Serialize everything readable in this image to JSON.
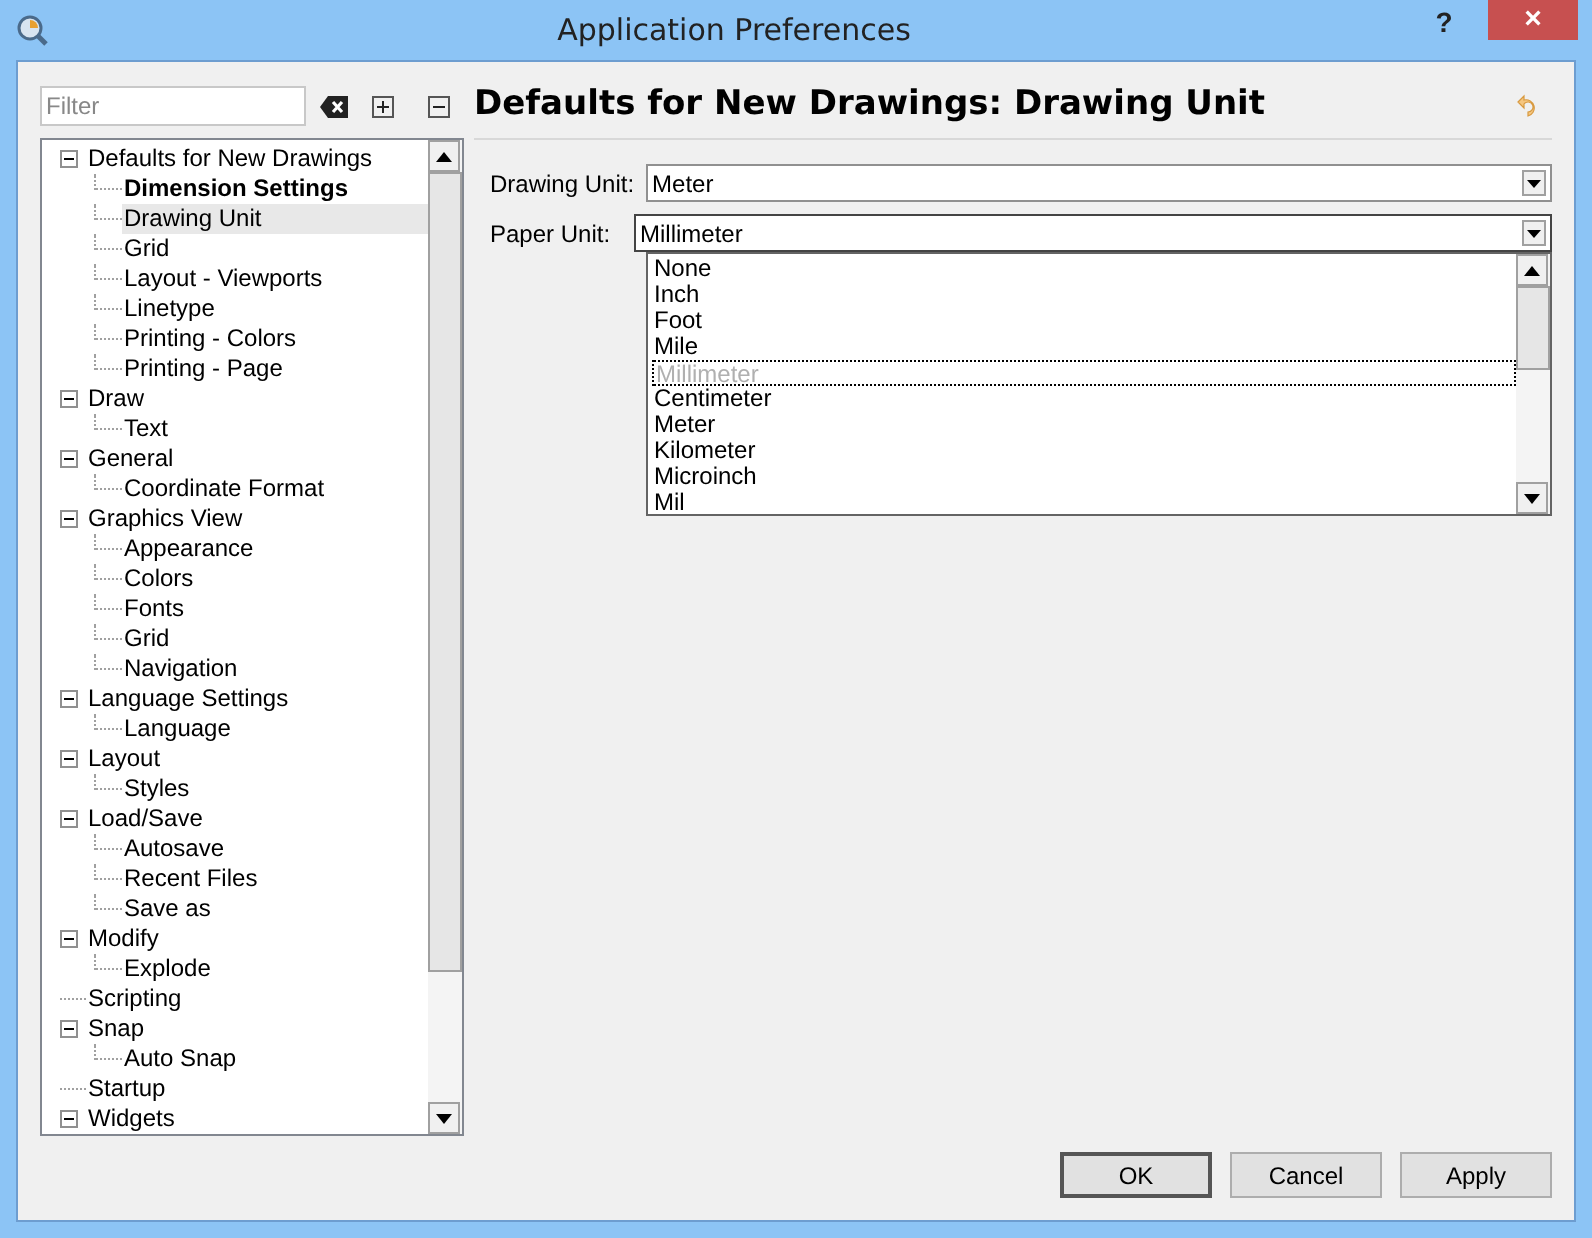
{
  "window": {
    "title": "Application Preferences",
    "help": "?",
    "close": "×"
  },
  "filter": {
    "placeholder": "Filter"
  },
  "tree": [
    {
      "label": "Defaults for New Drawings",
      "expanded": true,
      "selected": false,
      "children": [
        {
          "label": "Dimension Settings",
          "bold": true,
          "selected": false
        },
        {
          "label": "Drawing Unit",
          "bold": false,
          "selected": true
        },
        {
          "label": "Grid",
          "bold": false,
          "selected": false
        },
        {
          "label": "Layout - Viewports",
          "bold": false,
          "selected": false
        },
        {
          "label": "Linetype",
          "bold": false,
          "selected": false
        },
        {
          "label": "Printing - Colors",
          "bold": false,
          "selected": false
        },
        {
          "label": "Printing - Page",
          "bold": false,
          "selected": false
        }
      ]
    },
    {
      "label": "Draw",
      "expanded": true,
      "selected": false,
      "children": [
        {
          "label": "Text",
          "bold": false,
          "selected": false
        }
      ]
    },
    {
      "label": "General",
      "expanded": true,
      "selected": false,
      "children": [
        {
          "label": "Coordinate Format",
          "bold": false,
          "selected": false
        }
      ]
    },
    {
      "label": "Graphics View",
      "expanded": true,
      "selected": false,
      "children": [
        {
          "label": "Appearance",
          "bold": false,
          "selected": false
        },
        {
          "label": "Colors",
          "bold": false,
          "selected": false
        },
        {
          "label": "Fonts",
          "bold": false,
          "selected": false
        },
        {
          "label": "Grid",
          "bold": false,
          "selected": false
        },
        {
          "label": "Navigation",
          "bold": false,
          "selected": false
        }
      ]
    },
    {
      "label": "Language Settings",
      "expanded": true,
      "selected": false,
      "children": [
        {
          "label": "Language",
          "bold": false,
          "selected": false
        }
      ]
    },
    {
      "label": "Layout",
      "expanded": true,
      "selected": false,
      "children": [
        {
          "label": "Styles",
          "bold": false,
          "selected": false
        }
      ]
    },
    {
      "label": "Load/Save",
      "expanded": true,
      "selected": false,
      "children": [
        {
          "label": "Autosave",
          "bold": false,
          "selected": false
        },
        {
          "label": "Recent Files",
          "bold": false,
          "selected": false
        },
        {
          "label": "Save as",
          "bold": false,
          "selected": false
        }
      ]
    },
    {
      "label": "Modify",
      "expanded": true,
      "selected": false,
      "children": [
        {
          "label": "Explode",
          "bold": false,
          "selected": false
        }
      ]
    },
    {
      "label": "Scripting",
      "expanded": false,
      "selected": false
    },
    {
      "label": "Snap",
      "expanded": true,
      "selected": false,
      "children": [
        {
          "label": "Auto Snap",
          "bold": false,
          "selected": false
        }
      ]
    },
    {
      "label": "Startup",
      "expanded": false,
      "selected": false
    },
    {
      "label": "Widgets",
      "expanded": true,
      "selected": false
    }
  ],
  "page_title": "Defaults for New Drawings: Drawing Unit",
  "fields": [
    {
      "label": "Drawing Unit:",
      "value": "Meter",
      "open": false
    },
    {
      "label": "Paper Unit:",
      "value": "Millimeter",
      "open": true
    }
  ],
  "dropdown_options": [
    {
      "label": "None",
      "selected": false
    },
    {
      "label": "Inch",
      "selected": false
    },
    {
      "label": "Foot",
      "selected": false
    },
    {
      "label": "Mile",
      "selected": false
    },
    {
      "label": "Millimeter",
      "selected": true
    },
    {
      "label": "Centimeter",
      "selected": false
    },
    {
      "label": "Meter",
      "selected": false
    },
    {
      "label": "Kilometer",
      "selected": false
    },
    {
      "label": "Microinch",
      "selected": false
    },
    {
      "label": "Mil",
      "selected": false
    }
  ],
  "buttons": [
    {
      "label": "OK",
      "default": true
    },
    {
      "label": "Cancel",
      "default": false
    },
    {
      "label": "Apply",
      "default": false
    }
  ]
}
